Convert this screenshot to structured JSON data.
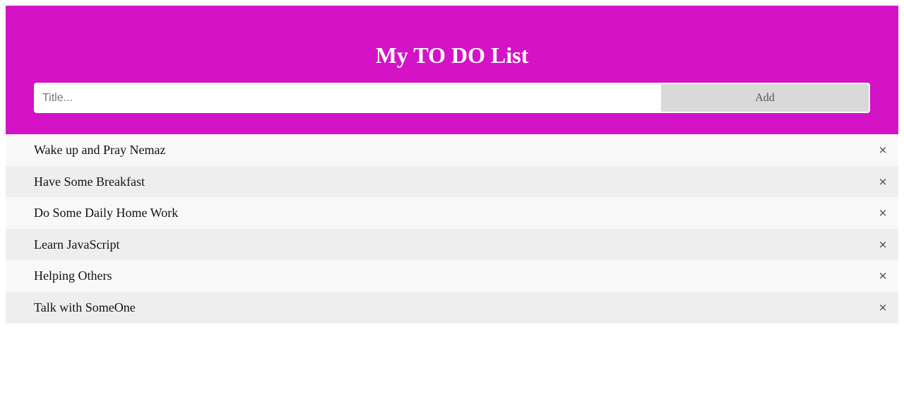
{
  "header": {
    "title": "My TO DO List",
    "background_color": "#d413c6"
  },
  "input": {
    "placeholder": "Title...",
    "value": ""
  },
  "add_button": {
    "label": "Add"
  },
  "todos": [
    {
      "text": "Wake up and Pray Nemaz",
      "close_icon": "×"
    },
    {
      "text": "Have Some Breakfast",
      "close_icon": "×"
    },
    {
      "text": "Do Some Daily Home Work",
      "close_icon": "×"
    },
    {
      "text": "Learn JavaScript",
      "close_icon": "×"
    },
    {
      "text": "Helping Others",
      "close_icon": "×"
    },
    {
      "text": "Talk with SomeOne",
      "close_icon": "×"
    }
  ]
}
